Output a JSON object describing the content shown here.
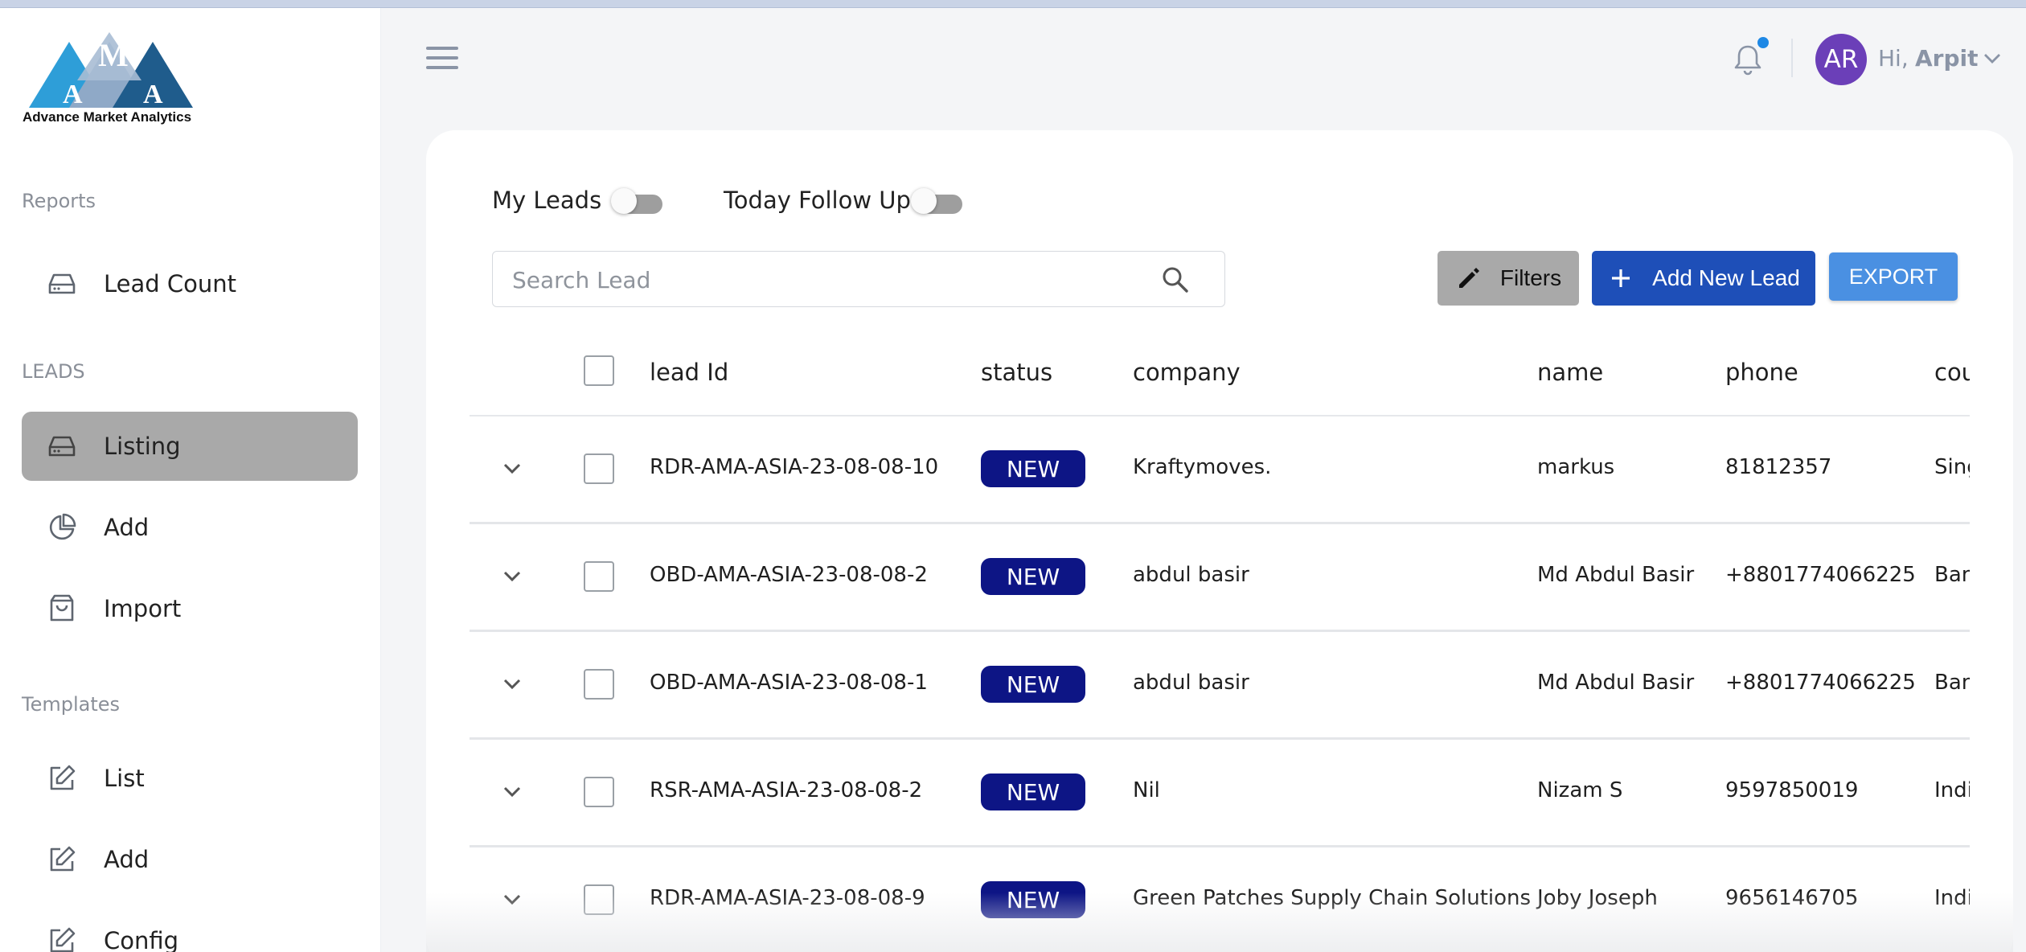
{
  "brand": {
    "logo_letters": [
      "A",
      "M",
      "A"
    ],
    "name": "Advance Market Analytics"
  },
  "sidebar": {
    "sections": [
      {
        "title": "Reports",
        "items": [
          {
            "label": "Lead Count",
            "icon": "inbox-icon"
          }
        ]
      },
      {
        "title": "LEADS",
        "items": [
          {
            "label": "Listing",
            "icon": "inbox-icon",
            "active": true
          },
          {
            "label": "Add",
            "icon": "pie-chart-icon"
          },
          {
            "label": "Import",
            "icon": "shopping-bag-icon"
          }
        ]
      },
      {
        "title": "Templates",
        "items": [
          {
            "label": "List",
            "icon": "edit-icon"
          },
          {
            "label": "Add",
            "icon": "edit-icon"
          },
          {
            "label": "Config",
            "icon": "edit-icon"
          }
        ]
      }
    ]
  },
  "header": {
    "avatar_initials": "AR",
    "greeting": "Hi,",
    "user_name": "Arpit"
  },
  "toolbar": {
    "my_leads_label": "My Leads",
    "my_leads_on": false,
    "today_followup_label": "Today Follow Up",
    "today_followup_on": false,
    "search_placeholder": "Search Lead",
    "search_value": "",
    "filters_label": "Filters",
    "add_label": "Add New Lead",
    "export_label": "EXPORT"
  },
  "table": {
    "columns": [
      "lead Id",
      "status",
      "company",
      "name",
      "phone",
      "cou"
    ],
    "rows": [
      {
        "lead_id": "RDR-AMA-ASIA-23-08-08-10",
        "status": "NEW",
        "company": "Kraftymoves.",
        "name": "markus",
        "phone": "81812357",
        "country": "Sing"
      },
      {
        "lead_id": "OBD-AMA-ASIA-23-08-08-2",
        "status": "NEW",
        "company": "abdul basir",
        "name": "Md Abdul Basir",
        "phone": "+8801774066225",
        "country": "Ban"
      },
      {
        "lead_id": "OBD-AMA-ASIA-23-08-08-1",
        "status": "NEW",
        "company": "abdul basir",
        "name": "Md Abdul Basir",
        "phone": "+8801774066225",
        "country": "Ban"
      },
      {
        "lead_id": "RSR-AMA-ASIA-23-08-08-2",
        "status": "NEW",
        "company": "Nil",
        "name": "Nizam S",
        "phone": "9597850019",
        "country": "Indi"
      },
      {
        "lead_id": "RDR-AMA-ASIA-23-08-08-9",
        "status": "NEW",
        "company": "Green Patches Supply Chain Solutions",
        "name": "Joby Joseph",
        "phone": "9656146705",
        "country": "Indi"
      }
    ]
  },
  "colors": {
    "accent": "#1e4fb8",
    "export": "#4a90e2",
    "badge": "#0d1585",
    "avatar": "#6b3fb8",
    "notification_dot": "#1e88e5",
    "sidebar_active": "#a9a9a9"
  }
}
